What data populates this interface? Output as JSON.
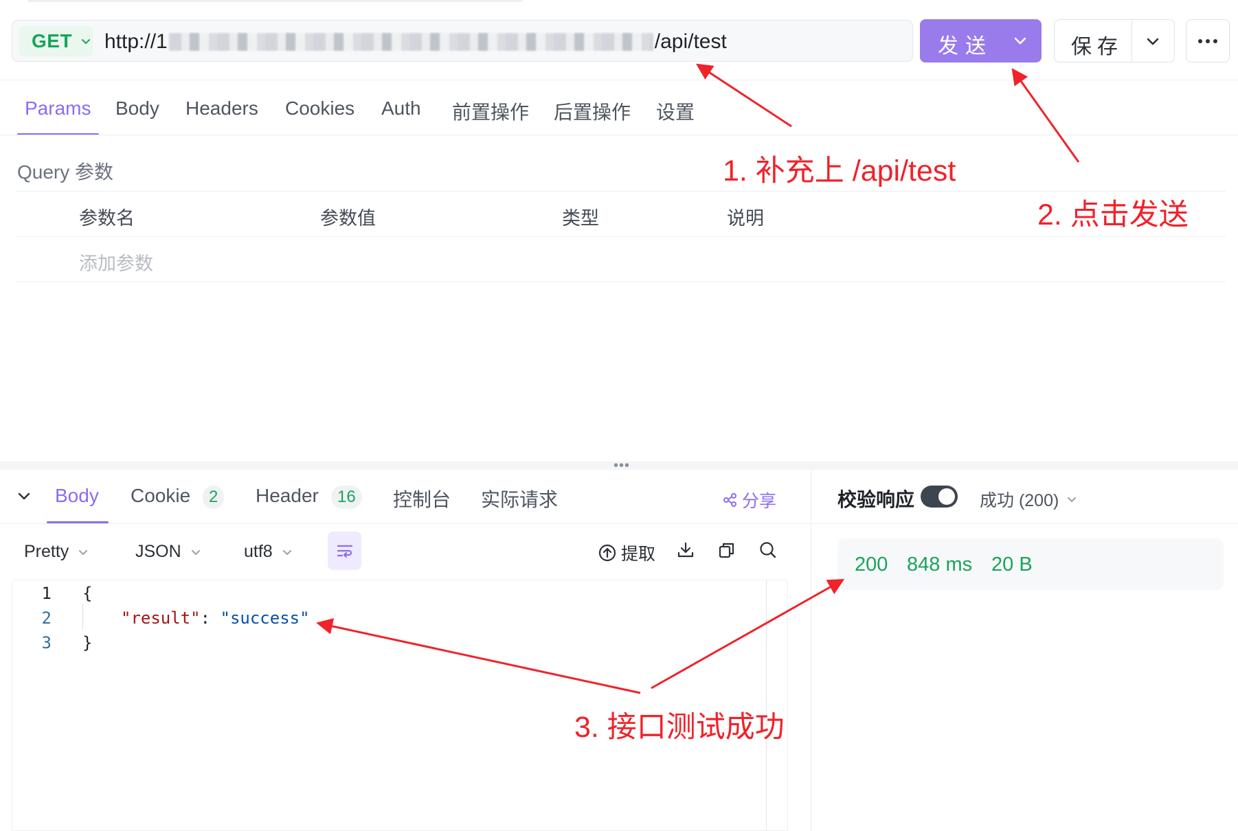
{
  "request": {
    "method": "GET",
    "url_prefix": "http://1",
    "url_suffix": "/api/test",
    "send_label": "发送",
    "save_label": "保存"
  },
  "request_tabs": [
    {
      "label": "Params",
      "active": true
    },
    {
      "label": "Body"
    },
    {
      "label": "Headers"
    },
    {
      "label": "Cookies"
    },
    {
      "label": "Auth"
    },
    {
      "label": "前置操作"
    },
    {
      "label": "后置操作"
    },
    {
      "label": "设置"
    }
  ],
  "query": {
    "title": "Query 参数",
    "columns": [
      "参数名",
      "参数值",
      "类型",
      "说明"
    ],
    "add_placeholder": "添加参数"
  },
  "response_tabs": [
    {
      "label": "Body",
      "active": true
    },
    {
      "label": "Cookie",
      "count": "2"
    },
    {
      "label": "Header",
      "count": "16"
    },
    {
      "label": "控制台"
    },
    {
      "label": "实际请求"
    }
  ],
  "share_label": "分享",
  "validation": {
    "label": "校验响应",
    "enabled": true,
    "status": "成功 (200)"
  },
  "response_toolbar": {
    "format": "Pretty",
    "type": "JSON",
    "encoding": "utf8",
    "extract_label": "提取"
  },
  "response_body": {
    "line_numbers": [
      "1",
      "2",
      "3"
    ],
    "open_brace": "{",
    "key": "\"result\"",
    "colon": ": ",
    "value": "\"success\"",
    "close_brace": "}"
  },
  "response_meta": {
    "status_code": "200",
    "time": "848 ms",
    "size": "20 B"
  },
  "annotations": {
    "step1": "1. 补充上 /api/test",
    "step2": "2. 点击发送",
    "step3": "3. 接口测试成功"
  },
  "colors": {
    "accent": "#8b6cf1",
    "send_button": "#9a7bec",
    "success": "#19a45a",
    "annotation": "#f0222a"
  },
  "icons": [
    "chevron-down-icon",
    "more-icon",
    "share-icon",
    "wrap-lines-icon",
    "extract-icon",
    "download-icon",
    "copy-icon",
    "search-icon"
  ]
}
